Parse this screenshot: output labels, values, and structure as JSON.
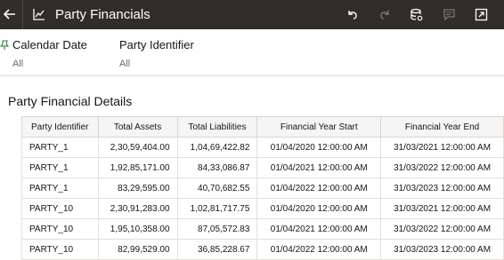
{
  "app": {
    "title": "Party Financials"
  },
  "icons": {
    "back": "back-arrow-icon",
    "app": "chart-icon",
    "undo": "undo-icon",
    "redo": "redo-icon",
    "data": "database-icon",
    "comment": "comment-icon",
    "expand": "expand-icon"
  },
  "filters": [
    {
      "label": "Calendar Date",
      "value": "All",
      "pinned": true
    },
    {
      "label": "Party Identifier",
      "value": "All",
      "pinned": false
    }
  ],
  "section": {
    "title": "Party Financial Details"
  },
  "table": {
    "columns": [
      "Party Identifier",
      "Total Assets",
      "Total Liabilities",
      "Financial Year Start",
      "Financial Year End"
    ],
    "rows": [
      [
        "PARTY_1",
        "2,30,59,404.00",
        "1,04,69,422.82",
        "01/04/2020 12:00:00 AM",
        "31/03/2021 12:00:00 AM"
      ],
      [
        "PARTY_1",
        "1,92,85,171.00",
        "84,33,086.87",
        "01/04/2021 12:00:00 AM",
        "31/03/2022 12:00:00 AM"
      ],
      [
        "PARTY_1",
        "83,29,595.00",
        "40,70,682.55",
        "01/04/2022 12:00:00 AM",
        "31/03/2023 12:00:00 AM"
      ],
      [
        "PARTY_10",
        "2,30,91,283.00",
        "1,02,81,717.75",
        "01/04/2020 12:00:00 AM",
        "31/03/2021 12:00:00 AM"
      ],
      [
        "PARTY_10",
        "1,95,10,358.00",
        "87,05,572.83",
        "01/04/2021 12:00:00 AM",
        "31/03/2022 12:00:00 AM"
      ],
      [
        "PARTY_10",
        "82,99,529.00",
        "36,85,228.67",
        "01/04/2022 12:00:00 AM",
        "31/03/2023 12:00:00 AM"
      ]
    ]
  },
  "colors": {
    "topbar": "#312d2a",
    "header_bg": "#f6f5f4",
    "border": "#d9d6d2"
  }
}
